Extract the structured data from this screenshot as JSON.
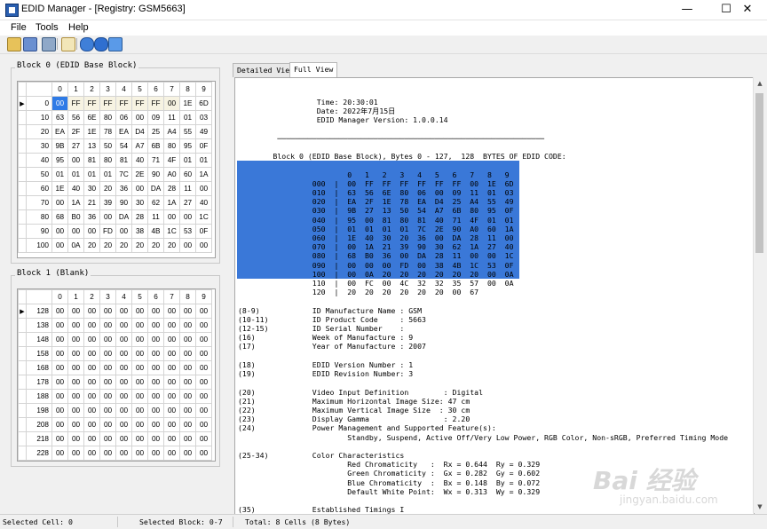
{
  "window": {
    "title": "EDID Manager - [Registry: GSM5663]"
  },
  "menu": [
    "File",
    "Tools",
    "Help"
  ],
  "toolbar_icons": [
    "open-folder-icon",
    "open-registry-icon",
    "save-icon",
    "edit-icon",
    "help-icon",
    "refresh-icon",
    "home-icon"
  ],
  "block0": {
    "label": "Block 0 (EDID Base Block)",
    "columns": [
      "0",
      "1",
      "2",
      "3",
      "4",
      "5",
      "6",
      "7",
      "8",
      "9"
    ],
    "rows": [
      {
        "addr": "0",
        "cells": [
          "00",
          "FF",
          "FF",
          "FF",
          "FF",
          "FF",
          "FF",
          "00",
          "1E",
          "6D"
        ]
      },
      {
        "addr": "10",
        "cells": [
          "63",
          "56",
          "6E",
          "80",
          "06",
          "00",
          "09",
          "11",
          "01",
          "03"
        ]
      },
      {
        "addr": "20",
        "cells": [
          "EA",
          "2F",
          "1E",
          "78",
          "EA",
          "D4",
          "25",
          "A4",
          "55",
          "49"
        ]
      },
      {
        "addr": "30",
        "cells": [
          "9B",
          "27",
          "13",
          "50",
          "54",
          "A7",
          "6B",
          "80",
          "95",
          "0F"
        ]
      },
      {
        "addr": "40",
        "cells": [
          "95",
          "00",
          "81",
          "80",
          "81",
          "40",
          "71",
          "4F",
          "01",
          "01"
        ]
      },
      {
        "addr": "50",
        "cells": [
          "01",
          "01",
          "01",
          "01",
          "7C",
          "2E",
          "90",
          "A0",
          "60",
          "1A"
        ]
      },
      {
        "addr": "60",
        "cells": [
          "1E",
          "40",
          "30",
          "20",
          "36",
          "00",
          "DA",
          "28",
          "11",
          "00"
        ]
      },
      {
        "addr": "70",
        "cells": [
          "00",
          "1A",
          "21",
          "39",
          "90",
          "30",
          "62",
          "1A",
          "27",
          "40"
        ]
      },
      {
        "addr": "80",
        "cells": [
          "68",
          "B0",
          "36",
          "00",
          "DA",
          "28",
          "11",
          "00",
          "00",
          "1C"
        ]
      },
      {
        "addr": "90",
        "cells": [
          "00",
          "00",
          "00",
          "FD",
          "00",
          "38",
          "4B",
          "1C",
          "53",
          "0F"
        ]
      },
      {
        "addr": "100",
        "cells": [
          "00",
          "0A",
          "20",
          "20",
          "20",
          "20",
          "20",
          "20",
          "00",
          "00"
        ]
      }
    ]
  },
  "block1": {
    "label": "Block 1 (Blank)",
    "columns": [
      "0",
      "1",
      "2",
      "3",
      "4",
      "5",
      "6",
      "7",
      "8",
      "9"
    ],
    "rows": [
      {
        "addr": "128",
        "cells": [
          "00",
          "00",
          "00",
          "00",
          "00",
          "00",
          "00",
          "00",
          "00",
          "00"
        ]
      },
      {
        "addr": "138",
        "cells": [
          "00",
          "00",
          "00",
          "00",
          "00",
          "00",
          "00",
          "00",
          "00",
          "00"
        ]
      },
      {
        "addr": "148",
        "cells": [
          "00",
          "00",
          "00",
          "00",
          "00",
          "00",
          "00",
          "00",
          "00",
          "00"
        ]
      },
      {
        "addr": "158",
        "cells": [
          "00",
          "00",
          "00",
          "00",
          "00",
          "00",
          "00",
          "00",
          "00",
          "00"
        ]
      },
      {
        "addr": "168",
        "cells": [
          "00",
          "00",
          "00",
          "00",
          "00",
          "00",
          "00",
          "00",
          "00",
          "00"
        ]
      },
      {
        "addr": "178",
        "cells": [
          "00",
          "00",
          "00",
          "00",
          "00",
          "00",
          "00",
          "00",
          "00",
          "00"
        ]
      },
      {
        "addr": "188",
        "cells": [
          "00",
          "00",
          "00",
          "00",
          "00",
          "00",
          "00",
          "00",
          "00",
          "00"
        ]
      },
      {
        "addr": "198",
        "cells": [
          "00",
          "00",
          "00",
          "00",
          "00",
          "00",
          "00",
          "00",
          "00",
          "00"
        ]
      },
      {
        "addr": "208",
        "cells": [
          "00",
          "00",
          "00",
          "00",
          "00",
          "00",
          "00",
          "00",
          "00",
          "00"
        ]
      },
      {
        "addr": "218",
        "cells": [
          "00",
          "00",
          "00",
          "00",
          "00",
          "00",
          "00",
          "00",
          "00",
          "00"
        ]
      },
      {
        "addr": "228",
        "cells": [
          "00",
          "00",
          "00",
          "00",
          "00",
          "00",
          "00",
          "00",
          "00",
          "00"
        ]
      }
    ]
  },
  "tabs": [
    "Detailed View",
    "Full View"
  ],
  "full_view_text": "                  Time: 20:30:01\n                  Date: 2022年7月15日\n                  EDID Manager Version: 1.0.0.14\n\n         ─────────────────────────────────────────────────────────────\n\n        Block 0 (EDID Base Block), Bytes 0 - 127,  128  BYTES OF EDID CODE:\n\n                         0   1   2   3   4   5   6   7   8   9\n                 000  |  00  FF  FF  FF  FF  FF  FF  00  1E  6D\n                 010  |  63  56  6E  80  06  00  09  11  01  03\n                 020  |  EA  2F  1E  78  EA  D4  25  A4  55  49\n                 030  |  9B  27  13  50  54  A7  6B  80  95  0F\n                 040  |  95  00  81  80  81  40  71  4F  01  01\n                 050  |  01  01  01  01  7C  2E  90  A0  60  1A\n                 060  |  1E  40  30  20  36  00  DA  28  11  00\n                 070  |  00  1A  21  39  90  30  62  1A  27  40\n                 080  |  68  B0  36  00  DA  28  11  00  00  1C\n                 090  |  00  00  00  FD  00  38  4B  1C  53  0F\n                 100  |  00  0A  20  20  20  20  20  20  00  0A\n                 110  |  00  FC  00  4C  32  32  35  57  00  0A\n                 120  |  20  20  20  20  20  20  00  67\n\n(8-9)            ID Manufacture Name : GSM\n(10-11)          ID Product Code     : 5663\n(12-15)          ID Serial Number    :\n(16)             Week of Manufacture : 9\n(17)             Year of Manufacture : 2007\n\n(18)             EDID Version Number : 1\n(19)             EDID Revision Number: 3\n\n(20)             Video Input Definition        : Digital\n(21)             Maximum Horizontal Image Size: 47 cm\n(22)             Maximum Vertical Image Size  : 30 cm\n(23)             Display Gamma                 : 2.20\n(24)             Power Management and Supported Feature(s):\n                         Standby, Suspend, Active Off/Very Low Power, RGB Color, Non-sRGB, Preferred Timing Mode\n\n(25-34)          Color Characteristics\n                         Red Chromaticity   :  Rx = 0.644  Ry = 0.329\n                         Green Chromaticity :  Gx = 0.282  Gy = 0.602\n                         Blue Chromaticity  :  Bx = 0.148  By = 0.072\n                         Default White Point:  Wx = 0.313  Wy = 0.329\n\n(35)             Established Timings I",
  "status": {
    "selected_cell": "Selected Cell: 0",
    "selected_block": "Selected Block: 0-7",
    "total": "Total: 8 Cells (8 Bytes)"
  },
  "watermark": {
    "main": "Bai 经验",
    "sub": "jingyan.baidu.com"
  },
  "colors": {
    "selection": "#3a78d8",
    "selected_cell": "#2f7be6",
    "cell_tan": "#f7f3e2"
  }
}
